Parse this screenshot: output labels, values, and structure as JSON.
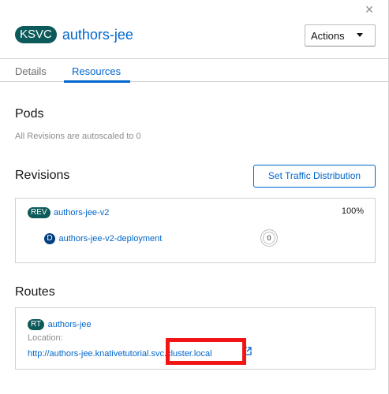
{
  "header": {
    "kind_badge": "KSVC",
    "title": "authors-jee",
    "actions_label": "Actions",
    "close_glyph": "×"
  },
  "tabs": [
    {
      "label": "Details",
      "active": false
    },
    {
      "label": "Resources",
      "active": true
    }
  ],
  "pods": {
    "title": "Pods",
    "message": "All Revisions are autoscaled to 0"
  },
  "revisions": {
    "title": "Revisions",
    "button_label": "Set Traffic Distribution",
    "items": [
      {
        "badge": "REV",
        "name": "authors-jee-v2",
        "traffic": "100%",
        "deployment": {
          "badge": "D",
          "name": "authors-jee-v2-deployment",
          "pods": "0"
        }
      }
    ]
  },
  "routes": {
    "title": "Routes",
    "items": [
      {
        "badge": "RT",
        "name": "authors-jee",
        "location_label": "Location:",
        "url": "http://authors-jee.knativetutorial.svc.cluster.local"
      }
    ]
  },
  "colors": {
    "link": "#0066cc",
    "ksvc_badge": "#0c5a5a",
    "deployment_badge": "#004080",
    "highlight": "#f21515"
  },
  "icons": [
    "close-icon",
    "caret-down-icon",
    "external-link-icon"
  ]
}
